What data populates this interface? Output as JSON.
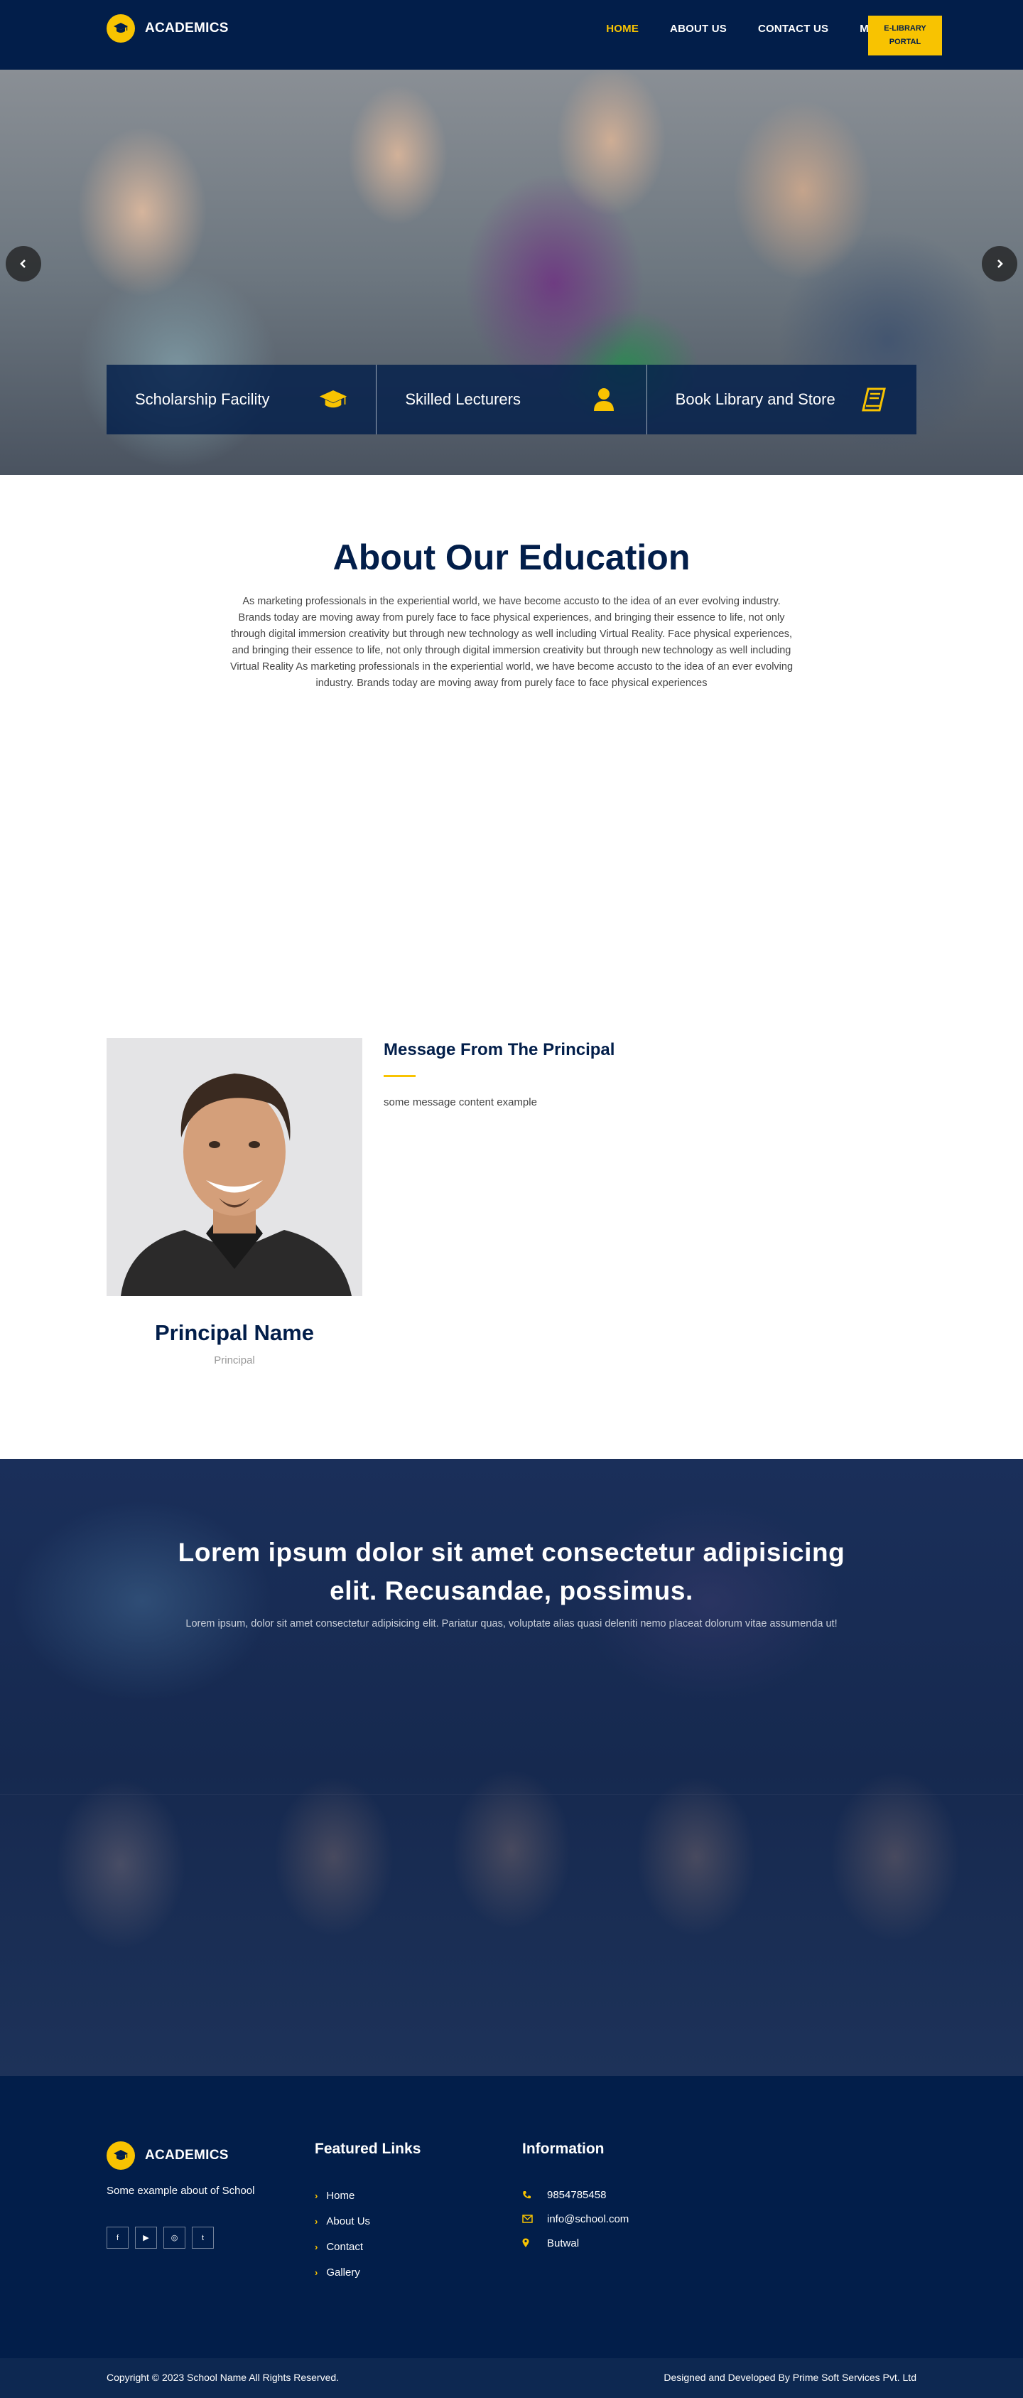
{
  "colors": {
    "navy": "#021e4a",
    "accent": "#f8c301"
  },
  "header": {
    "brand": "ACADEMICS",
    "logo_icon": "graduation-cap-icon",
    "nav": [
      {
        "label": "HOME",
        "active": true
      },
      {
        "label": "ABOUT US",
        "active": false
      },
      {
        "label": "CONTACT US",
        "active": false
      },
      {
        "label": "MORE",
        "active": false
      }
    ],
    "portal_button": "E-LIBRARY PORTAL"
  },
  "hero": {
    "prev_icon": "chevron-left-icon",
    "next_icon": "chevron-right-icon",
    "features": [
      {
        "title": "Scholarship Facility",
        "icon": "graduation-cap-icon"
      },
      {
        "title": "Skilled Lecturers",
        "icon": "user-icon"
      },
      {
        "title": "Book Library and Store",
        "icon": "book-icon"
      }
    ]
  },
  "about": {
    "title": "About Our Education",
    "text": "As marketing professionals in the experiential world, we have become accusto to the idea of an ever evolving industry. Brands today are moving away from purely face to face physical experiences, and bringing their essence to life, not only through digital immersion creativity but through new technology as well including Virtual Reality. Face physical experiences, and bringing their essence to life, not only through digital immersion creativity but through new technology as well including Virtual Reality As marketing professionals in the experiential world, we have become accusto to the idea of an ever evolving industry. Brands today are moving away from purely face to face physical experiences"
  },
  "principal": {
    "message_title": "Message From The Principal",
    "message_text": "some message content example",
    "name": "Principal Name",
    "role": "Principal"
  },
  "banner": {
    "title": "Lorem ipsum dolor sit amet consectetur adipisicing elit. Recusandae, possimus.",
    "subtitle": "Lorem ipsum, dolor sit amet consectetur adipisicing elit. Pariatur quas, voluptate alias quasi deleniti nemo placeat dolorum vitae assumenda ut!"
  },
  "footer": {
    "brand": "ACADEMICS",
    "about": "Some example about of School",
    "socials": [
      {
        "icon": "facebook-icon",
        "glyph": "f"
      },
      {
        "icon": "youtube-icon",
        "glyph": "▶"
      },
      {
        "icon": "instagram-icon",
        "glyph": "◎"
      },
      {
        "icon": "twitter-icon",
        "glyph": "t"
      }
    ],
    "featured_title": "Featured Links",
    "links": [
      "Home",
      "About Us",
      "Contact",
      "Gallery"
    ],
    "info_title": "Information",
    "info": [
      {
        "icon": "phone-icon",
        "text": "9854785458"
      },
      {
        "icon": "envelope-icon",
        "text": "info@school.com"
      },
      {
        "icon": "map-marker-icon",
        "text": "Butwal"
      }
    ],
    "copyright": "Copyright © 2023 School Name All Rights Reserved.",
    "credit": "Designed and Developed By Prime Soft Services Pvt. Ltd"
  }
}
